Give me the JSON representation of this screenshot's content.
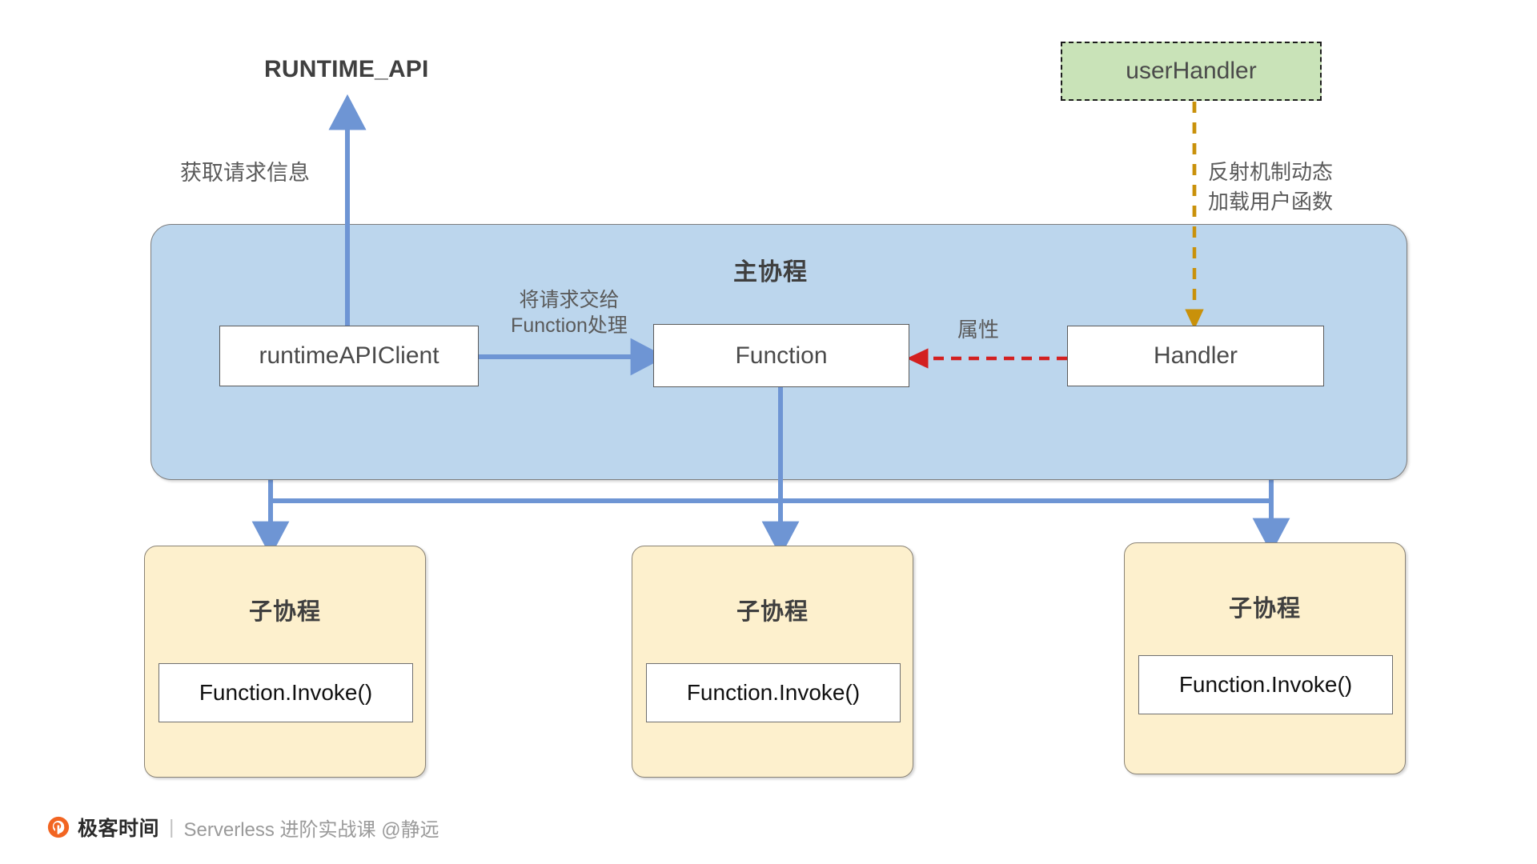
{
  "diagram": {
    "title_top": "RUNTIME_API",
    "main_container": {
      "title": "主协程",
      "fill_color": "#bcd6ed",
      "border_color": "#7d7d7d"
    },
    "nodes": {
      "runtime_api_client": "runtimeAPIClient",
      "function": "Function",
      "handler": "Handler",
      "user_handler": "userHandler"
    },
    "edge_labels": {
      "fetch_request": "获取请求信息",
      "hand_to_function": "将请求交给\nFunction处理",
      "attribute": "属性",
      "reflection_load": "反射机制动态\n加载用户函数"
    },
    "colors": {
      "blue_arrow": "#6e95d4",
      "red_dashed_arrow": "#d32020",
      "gold_dashed_arrow": "#c9910a",
      "green_box_fill": "#c9e3b8",
      "yellow_card_fill": "#fdf0cd",
      "blue_container_fill": "#bcd6ed"
    },
    "sub_coroutines": [
      {
        "title": "子协程",
        "invoke": "Function.Invoke()"
      },
      {
        "title": "子协程",
        "invoke": "Function.Invoke()"
      },
      {
        "title": "子协程",
        "invoke": "Function.Invoke()"
      }
    ]
  },
  "footer": {
    "logo_icon": "geekbang-logo-icon",
    "brand": "极客时间",
    "divider": "|",
    "course": "Serverless 进阶实战课 @静远"
  }
}
